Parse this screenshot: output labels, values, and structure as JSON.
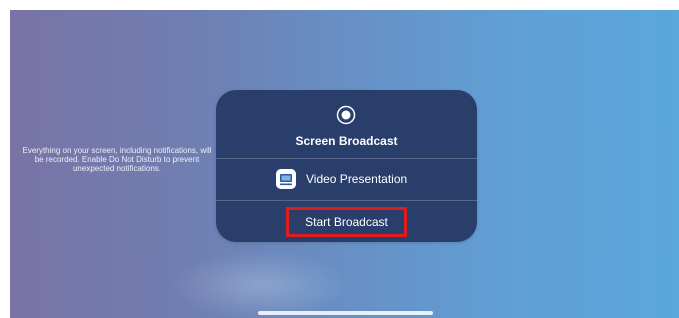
{
  "info": {
    "text": "Everything on your screen, including notifications, will be recorded. Enable Do Not Disturb to prevent unexpected notifications."
  },
  "panel": {
    "title": "Screen Broadcast",
    "title_icon": "record-icon",
    "app": {
      "label": "Video Presentation",
      "icon": "video-presentation-app-icon"
    },
    "start_label": "Start Broadcast"
  },
  "colors": {
    "panel_background": "#2a3e6b",
    "highlight_border": "#e01c1c",
    "background_left": "#7a73a6",
    "background_right": "#5aa7dc"
  }
}
